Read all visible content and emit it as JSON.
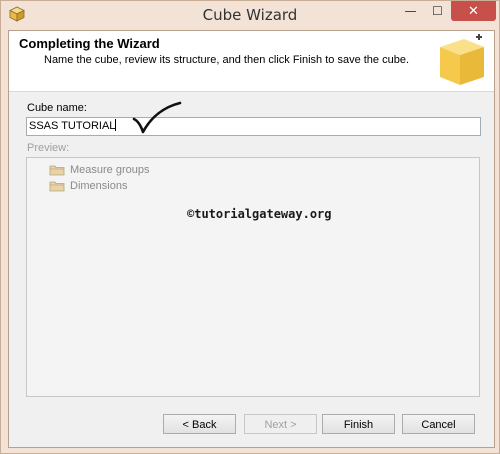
{
  "window": {
    "title": "Cube Wizard",
    "min_label": "—",
    "max_label": "☐",
    "close_label": "✕"
  },
  "header": {
    "title": "Completing the Wizard",
    "subtitle": "Name the cube, review its structure, and then click Finish to save the cube."
  },
  "cube_name": {
    "label": "Cube name:",
    "value": "SSAS TUTORIAL"
  },
  "preview": {
    "label": "Preview:",
    "items": [
      {
        "label": "Measure groups",
        "icon": "folder-icon"
      },
      {
        "label": "Dimensions",
        "icon": "folder-icon"
      }
    ],
    "watermark": "©tutorialgateway.org"
  },
  "buttons": {
    "back": "< Back",
    "next": "Next >",
    "finish": "Finish",
    "cancel": "Cancel"
  },
  "colors": {
    "frame": "#f2e3d6",
    "close": "#c7504b",
    "cube": "#f5c94c"
  }
}
